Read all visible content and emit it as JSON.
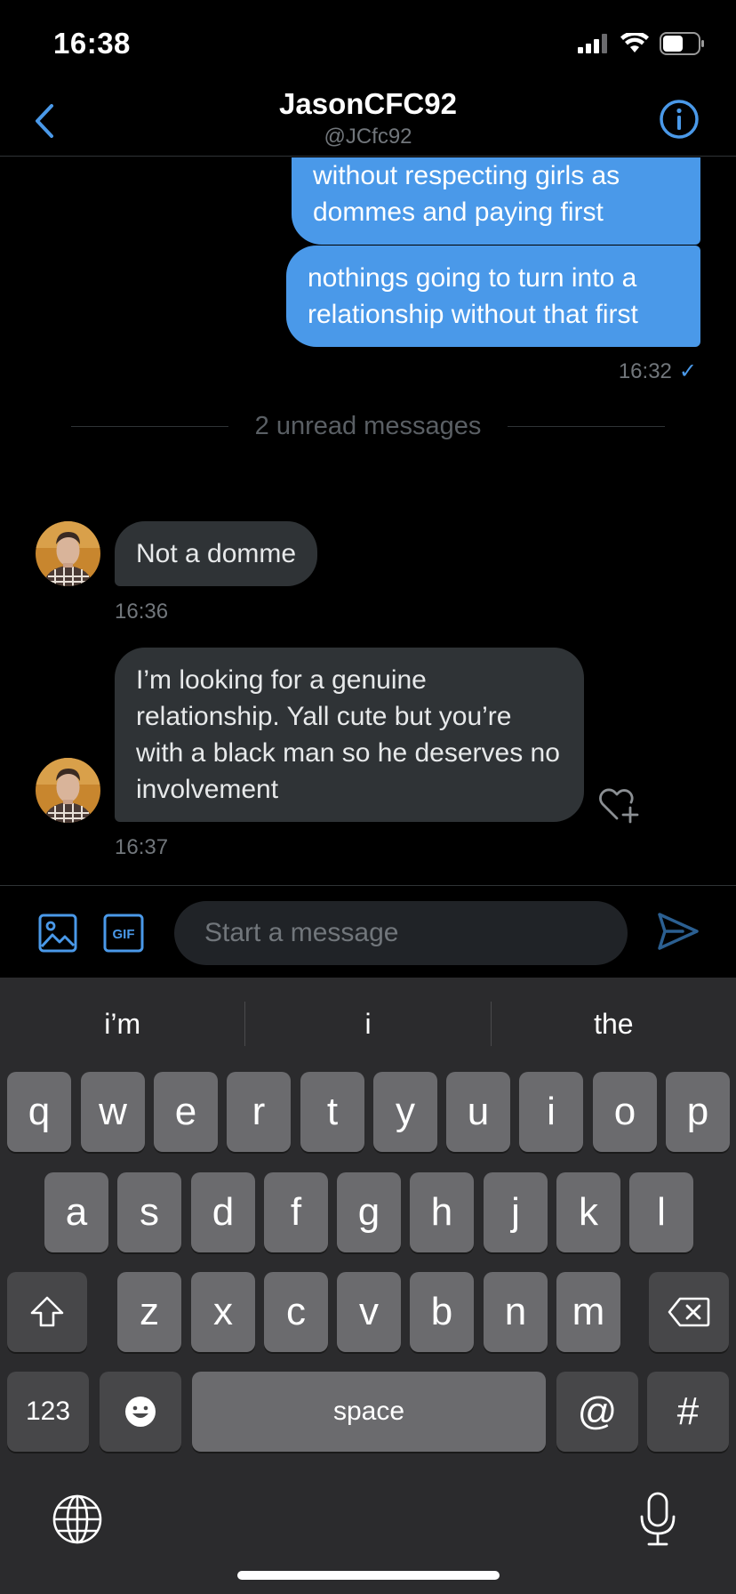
{
  "status_bar": {
    "time": "16:38"
  },
  "header": {
    "title": "JasonCFC92",
    "subtitle": "@JCfc92"
  },
  "messages_out": [
    {
      "text": "without respecting girls as dommes and paying first"
    },
    {
      "text": "nothings going to turn into a relationship without that first"
    }
  ],
  "out_time": "16:32",
  "out_status": "✓",
  "unread_divider": "2 unread messages",
  "messages_in": [
    {
      "text": "Not a domme",
      "time": "16:36"
    },
    {
      "text": "I’m looking for a genuine relationship. Yall cute but you’re with a black man so he deserves no involvement",
      "time": "16:37"
    }
  ],
  "composer": {
    "placeholder": "Start a message",
    "gif_label": "GIF"
  },
  "keyboard": {
    "suggestions": [
      "i’m",
      "i",
      "the"
    ],
    "row1": [
      "q",
      "w",
      "e",
      "r",
      "t",
      "y",
      "u",
      "i",
      "o",
      "p"
    ],
    "row2": [
      "a",
      "s",
      "d",
      "f",
      "g",
      "h",
      "j",
      "k",
      "l"
    ],
    "row3": [
      "z",
      "x",
      "c",
      "v",
      "b",
      "n",
      "m"
    ],
    "numbers_label": "123",
    "space_label": "space",
    "at_label": "@",
    "hash_label": "#"
  },
  "colors": {
    "accent": "#4a99e9",
    "bubble_in": "#2f3336",
    "background": "#000000"
  }
}
